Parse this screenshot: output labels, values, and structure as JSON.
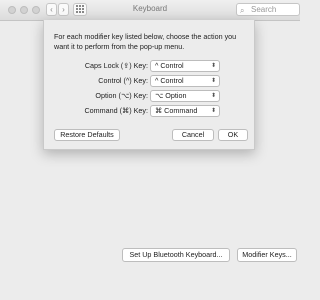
{
  "window": {
    "title": "Keyboard",
    "search_placeholder": "Search",
    "toolbar_grid_icon": "grid-icon",
    "back_icon": "‹",
    "forward_icon": "›"
  },
  "sheet": {
    "intro": "For each modifier key listed below, choose the action you want it to perform from the pop-up menu.",
    "rows": [
      {
        "label": "Caps Lock (⇪) Key:",
        "value": "^ Control"
      },
      {
        "label": "Control (^) Key:",
        "value": "^ Control"
      },
      {
        "label": "Option (⌥) Key:",
        "value": "⌥ Option"
      },
      {
        "label": "Command (⌘) Key:",
        "value": "⌘ Command"
      }
    ],
    "restore_label": "Restore Defaults",
    "cancel_label": "Cancel",
    "ok_label": "OK"
  },
  "bottom": {
    "bluetooth_label": "Set Up Bluetooth Keyboard...",
    "modifier_label": "Modifier Keys..."
  }
}
